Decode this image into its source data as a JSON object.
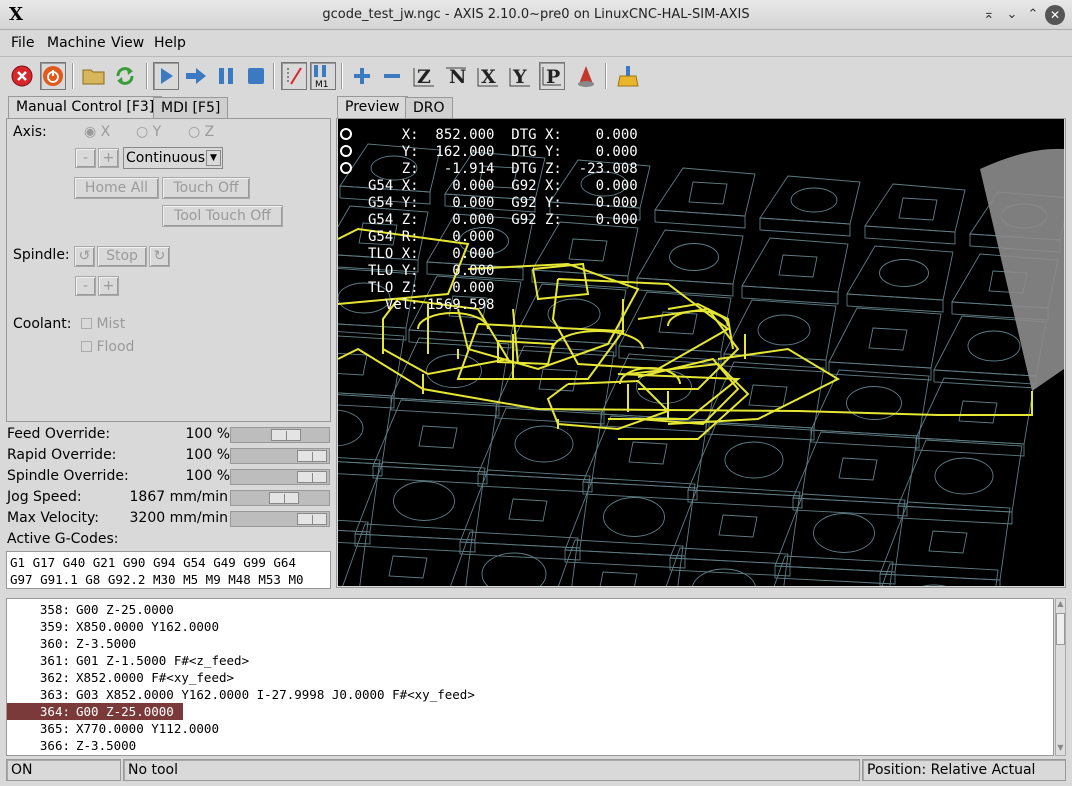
{
  "window": {
    "title": "gcode_test_jw.ngc - AXIS 2.10.0~pre0 on LinuxCNC-HAL-SIM-AXIS",
    "logo": "X"
  },
  "menubar": [
    "File",
    "Machine",
    "View",
    "Help"
  ],
  "toolbar": {
    "icons": [
      "estop-icon",
      "power-icon",
      "open-file-icon",
      "reload-icon",
      "run-icon",
      "step-icon",
      "pause-icon",
      "stop-icon",
      "block-delete-icon",
      "optional-stop-icon",
      "zoom-in-icon",
      "zoom-out-icon",
      "view-z-icon",
      "view-z2-icon",
      "view-x-icon",
      "view-y-icon",
      "view-p-icon",
      "rotate-icon",
      "clear-plot-icon"
    ],
    "m1_label": "M1"
  },
  "left_tabs": [
    "Manual Control [F3]",
    "MDI [F5]"
  ],
  "manual": {
    "axis_label": "Axis:",
    "axes": [
      "X",
      "Y",
      "Z"
    ],
    "jog_minus": "-",
    "jog_plus": "+",
    "jog_mode": "Continuous",
    "home_all": "Home All",
    "touch_off": "Touch Off",
    "tool_touch_off": "Tool Touch Off",
    "spindle_label": "Spindle:",
    "spindle_stop": "Stop",
    "coolant_label": "Coolant:",
    "mist": "Mist",
    "flood": "Flood"
  },
  "overrides": [
    {
      "label": "Feed Override:",
      "value": "100 %",
      "level": 0.6
    },
    {
      "label": "Rapid Override:",
      "value": "100 %",
      "level": 1.0
    },
    {
      "label": "Spindle Override:",
      "value": "100 %",
      "level": 1.0
    },
    {
      "label": "Jog Speed:",
      "value": "1867 mm/min",
      "level": 0.58
    },
    {
      "label": "Max Velocity:",
      "value": "3200 mm/min",
      "level": 1.0
    }
  ],
  "active_gcodes_label": "Active G-Codes:",
  "active_gcodes": [
    "G1 G17 G40 G21 G90 G94 G54 G49 G99 G64",
    "G97 G91.1 G8 G92.2 M30 M5 M9 M48 M53 M0"
  ],
  "right_tabs": [
    "Preview",
    "DRO"
  ],
  "dro": [
    "    X:  852.000  DTG X:    0.000",
    "    Y:  162.000  DTG Y:    0.000",
    "    Z:   -1.914  DTG Z:  -23.008",
    "G54 X:    0.000  G92 X:    0.000",
    "G54 Y:    0.000  G92 Y:    0.000",
    "G54 Z:    0.000  G92 Z:    0.000",
    "G54 R:    0.000",
    "TLO X:    0.000",
    "TLO Y:    0.000",
    "TLO Z:    0.000",
    "  Vel: 1569.598"
  ],
  "code_lines": [
    {
      "num": "358:",
      "text": "G00 Z-25.0000"
    },
    {
      "num": "359:",
      "text": "X850.0000 Y162.0000"
    },
    {
      "num": "360:",
      "text": "Z-3.5000"
    },
    {
      "num": "361:",
      "text": "G01 Z-1.5000 F#<z_feed>"
    },
    {
      "num": "362:",
      "text": "X852.0000 F#<xy_feed>"
    },
    {
      "num": "363:",
      "text": "G03 X852.0000 Y162.0000 I-27.9998 J0.0000 F#<xy_feed>"
    },
    {
      "num": "364:",
      "text": "G00 Z-25.0000"
    },
    {
      "num": "365:",
      "text": "X770.0000 Y112.0000"
    },
    {
      "num": "366:",
      "text": "Z-3.5000"
    }
  ],
  "selected_line": "364:",
  "status": {
    "state": "ON",
    "tool": "No tool",
    "position": "Position: Relative Actual"
  },
  "colors": {
    "toolpath": "#e6e635",
    "highlight": "#7b3a3a",
    "background": "#000000"
  }
}
